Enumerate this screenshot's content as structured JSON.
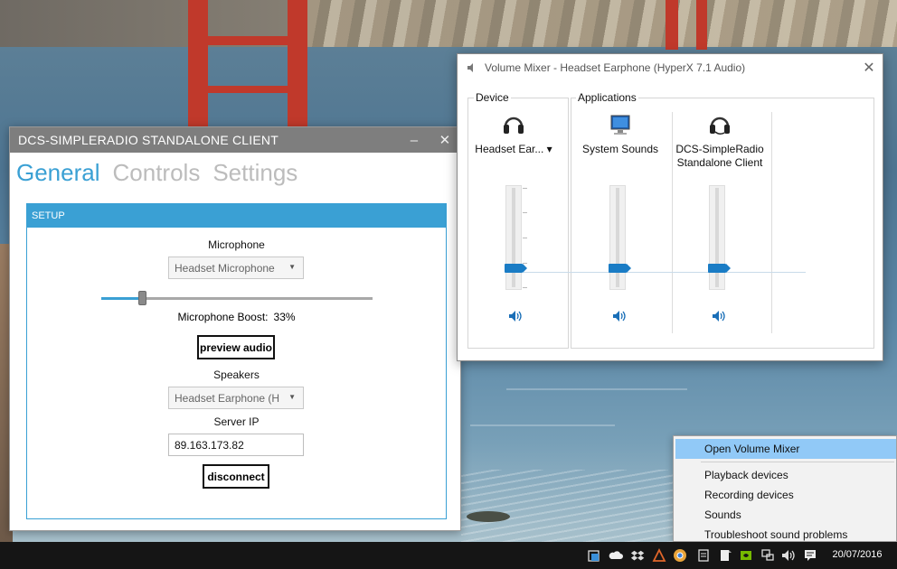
{
  "srs": {
    "title": "DCS-SIMPLERADIO STANDALONE CLIENT",
    "minimize_glyph": "–",
    "close_glyph": "✕",
    "tabs": [
      {
        "label": "General",
        "active": true
      },
      {
        "label": "Controls",
        "active": false
      },
      {
        "label": "Settings",
        "active": false
      }
    ],
    "setup": {
      "header": "SETUP",
      "microphone_label": "Microphone",
      "microphone_value": "Headset Microphone",
      "mic_slider_fraction": 0.15,
      "boost_label": "Microphone Boost:",
      "boost_value": "33%",
      "preview_button": "preview audio",
      "speakers_label": "Speakers",
      "speakers_value": "Headset Earphone (H",
      "server_ip_label": "Server IP",
      "server_ip_value": "89.163.173.82",
      "disconnect_button": "disconnect"
    }
  },
  "mixer": {
    "title": "Volume Mixer - Headset Earphone (HyperX 7.1 Audio)",
    "close_glyph": "✕",
    "device_group_label": "Device",
    "applications_group_label": "Applications",
    "channels": [
      {
        "name": "Headset Ear... ▾",
        "icon": "headset-icon",
        "level_fraction": 0.16
      },
      {
        "name": "System Sounds",
        "icon": "system-sounds-icon",
        "level_fraction": 0.16
      },
      {
        "name": "DCS-SimpleRadio Standalone Client",
        "icon": "headset-icon",
        "level_fraction": 0.16
      }
    ]
  },
  "context_menu": {
    "items": [
      {
        "label": "Open Volume Mixer",
        "highlighted": true
      },
      {
        "label": "Playback devices",
        "highlighted": false
      },
      {
        "label": "Recording devices",
        "highlighted": false
      },
      {
        "label": "Sounds",
        "highlighted": false
      },
      {
        "label": "Troubleshoot sound problems",
        "highlighted": false
      }
    ]
  },
  "taskbar": {
    "date": "20/07/2016",
    "tray_icons": [
      "shield-icon",
      "onedrive-icon",
      "dropbox-icon",
      "app-icon",
      "chrome-icon",
      "notes-icon",
      "nvidia-icon",
      "network-icon",
      "volume-icon",
      "notification-icon"
    ]
  },
  "colors": {
    "accent": "#3aa0d4",
    "mixer_thumb": "#1a7cc5",
    "menu_highlight": "#91c9f7",
    "taskbar": "#151515"
  }
}
